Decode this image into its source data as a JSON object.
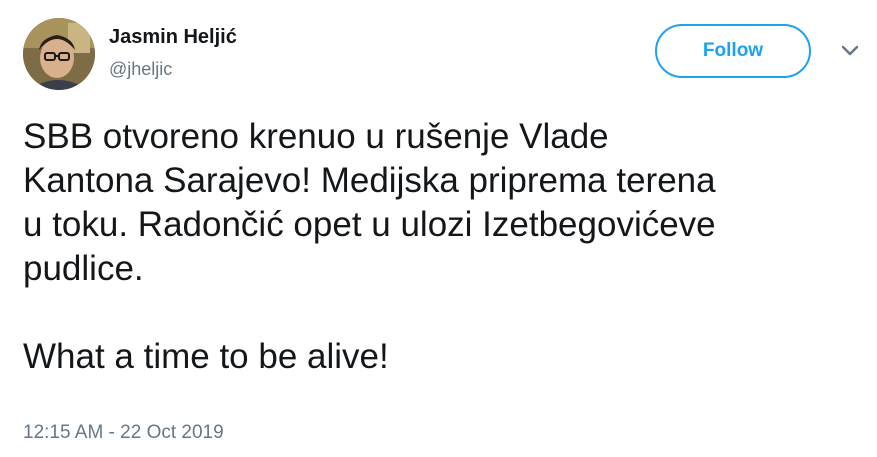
{
  "author": {
    "display_name": "Jasmin Heljić",
    "handle": "@jheljic"
  },
  "follow_button": {
    "label": "Follow",
    "color": "#1da1f2"
  },
  "menu_icon": "chevron-down-icon",
  "tweet": {
    "lines": [
      "SBB otvoreno krenuo u rušenje Vlade",
      "Kantona Sarajevo! Medijska priprema terena",
      "u toku. Radončić opet u ulozi Izetbegovićeve",
      "pudlice."
    ],
    "closing_line": "What a time to be alive!",
    "timestamp": "12:15 AM - 22 Oct 2019"
  }
}
